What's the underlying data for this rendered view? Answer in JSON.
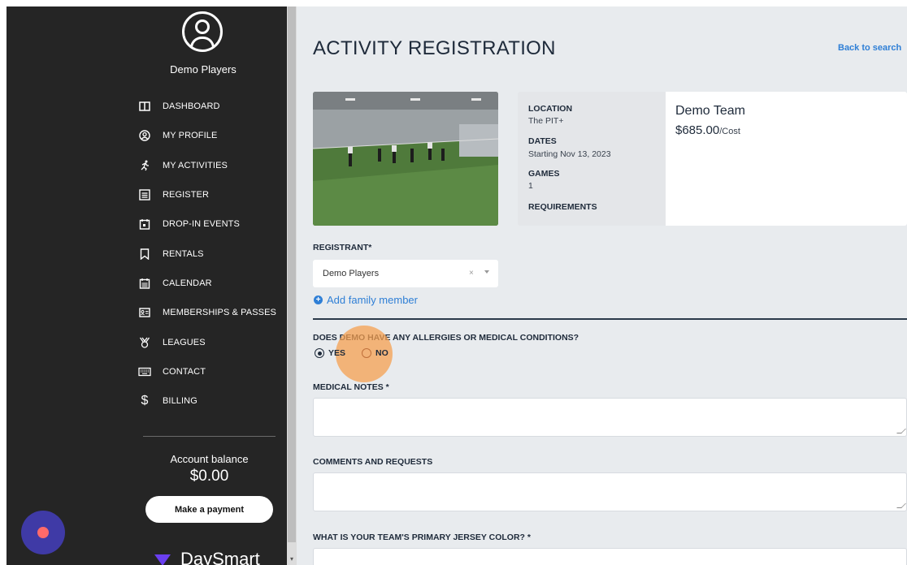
{
  "sidebar": {
    "user_name": "Demo Players",
    "nav_items": [
      {
        "label": "DASHBOARD",
        "icon": "dashboard-icon"
      },
      {
        "label": "MY PROFILE",
        "icon": "profile-icon"
      },
      {
        "label": "MY ACTIVITIES",
        "icon": "runner-icon"
      },
      {
        "label": "REGISTER",
        "icon": "list-icon"
      },
      {
        "label": "DROP-IN EVENTS",
        "icon": "calendar-event-icon"
      },
      {
        "label": "RENTALS",
        "icon": "bookmark-icon"
      },
      {
        "label": "CALENDAR",
        "icon": "calendar-icon"
      },
      {
        "label": "MEMBERSHIPS & PASSES",
        "icon": "id-card-icon"
      },
      {
        "label": "LEAGUES",
        "icon": "medal-icon"
      },
      {
        "label": "CONTACT",
        "icon": "keyboard-icon"
      },
      {
        "label": "BILLING",
        "icon": "dollar-icon"
      }
    ],
    "balance_label": "Account balance",
    "balance_amount": "$0.00",
    "payment_button": "Make a payment",
    "brand": "DaySmart"
  },
  "main": {
    "title": "ACTIVITY REGISTRATION",
    "back_link": "Back to search",
    "info": {
      "location_label": "LOCATION",
      "location_value": "The PIT+",
      "dates_label": "DATES",
      "dates_value": "Starting Nov 13, 2023",
      "games_label": "GAMES",
      "games_value": "1",
      "requirements_label": "REQUIREMENTS"
    },
    "team": {
      "name": "Demo Team",
      "price": "$685.00",
      "price_unit": "/Cost"
    },
    "form": {
      "registrant_label": "REGISTRANT*",
      "registrant_value": "Demo Players",
      "clear_symbol": "×",
      "add_family": "Add family member",
      "allergy_question": "DOES DEMO HAVE ANY ALLERGIES OR MEDICAL CONDITIONS?",
      "option_yes": "YES",
      "option_no": "NO",
      "selected_option": "YES",
      "medical_notes_label": "MEDICAL NOTES *",
      "comments_label": "COMMENTS AND REQUESTS",
      "jersey_label": "WHAT IS YOUR TEAM'S PRIMARY JERSEY COLOR? *"
    }
  },
  "colors": {
    "sidebar_bg": "#252525",
    "accent_link": "#2f7fd6",
    "click_highlight": "#f5a050"
  }
}
